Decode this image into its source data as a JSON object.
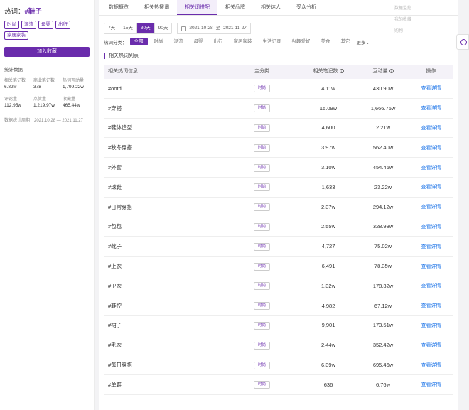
{
  "sidebar": {
    "title_prefix": "热词：",
    "keyword": "#鞋子",
    "tags": [
      "时尚",
      "潮流",
      "母婴",
      "出行",
      "家居家装"
    ],
    "fav_button": "加入收藏",
    "stats_title": "统计数据",
    "stats": [
      {
        "label": "相关笔记数",
        "value": "6.82w"
      },
      {
        "label": "商业笔记数",
        "value": "378"
      },
      {
        "label": "热词互动量",
        "value": "1,799.22w"
      },
      {
        "label": "评论量",
        "value": "112.95w"
      },
      {
        "label": "点赞量",
        "value": "1,219.97w"
      },
      {
        "label": "收藏量",
        "value": "465.44w"
      }
    ],
    "period": "数据统计周期：2021.10.28 — 2021.11.27"
  },
  "tabs": [
    "数据概览",
    "相关热搜词",
    "相关词搭配",
    "相关品牌",
    "相关达人",
    "受众分析"
  ],
  "active_tab": 2,
  "date_buttons": [
    "7天",
    "15天",
    "30天",
    "90天"
  ],
  "date_range": {
    "start": "2021-10-28",
    "sep": "至",
    "end": "2021-11-27"
  },
  "category_label": "热词分类：",
  "categories": [
    "全部",
    "时尚",
    "潮流",
    "母婴",
    "出行",
    "家居家装",
    "生活记录",
    "兴趣爱好",
    "美食",
    "其它"
  ],
  "more_label": "更多",
  "section_title": "相关热词列表",
  "table": {
    "headers": [
      "相关热词信息",
      "主分类",
      "相关笔记数",
      "互动量",
      "操作"
    ],
    "action_label": "查看详情",
    "rows": [
      {
        "word": "#ootd",
        "cat": "时尚",
        "notes": "4.11w",
        "inter": "430.90w"
      },
      {
        "word": "#穿搭",
        "cat": "时尚",
        "notes": "15.09w",
        "inter": "1,666.75w"
      },
      {
        "word": "#鞋体造型",
        "cat": "时尚",
        "notes": "4,600",
        "inter": "2.21w"
      },
      {
        "word": "#秋冬穿搭",
        "cat": "时尚",
        "notes": "3.97w",
        "inter": "562.40w"
      },
      {
        "word": "#外套",
        "cat": "时尚",
        "notes": "3.10w",
        "inter": "454.46w"
      },
      {
        "word": "#球鞋",
        "cat": "时尚",
        "notes": "1,633",
        "inter": "23.22w"
      },
      {
        "word": "#日常穿搭",
        "cat": "时尚",
        "notes": "2.37w",
        "inter": "294.12w"
      },
      {
        "word": "#包包",
        "cat": "时尚",
        "notes": "2.55w",
        "inter": "328.98w"
      },
      {
        "word": "#靴子",
        "cat": "时尚",
        "notes": "4,727",
        "inter": "75.02w"
      },
      {
        "word": "#上衣",
        "cat": "时尚",
        "notes": "6,491",
        "inter": "78.35w"
      },
      {
        "word": "#卫衣",
        "cat": "时尚",
        "notes": "1.32w",
        "inter": "178.32w"
      },
      {
        "word": "#鞋控",
        "cat": "时尚",
        "notes": "4,982",
        "inter": "67.12w"
      },
      {
        "word": "#裙子",
        "cat": "时尚",
        "notes": "9,901",
        "inter": "173.51w"
      },
      {
        "word": "#毛衣",
        "cat": "时尚",
        "notes": "2.44w",
        "inter": "352.42w"
      },
      {
        "word": "#每日穿搭",
        "cat": "时尚",
        "notes": "6.39w",
        "inter": "695.46w"
      },
      {
        "word": "#单鞋",
        "cat": "时尚",
        "notes": "636",
        "inter": "6.76w"
      }
    ]
  },
  "ghost_menu": [
    "数据监控",
    "我的收藏",
    "购物"
  ],
  "colors": {
    "accent": "#6a2cac",
    "link": "#1a73e8"
  }
}
